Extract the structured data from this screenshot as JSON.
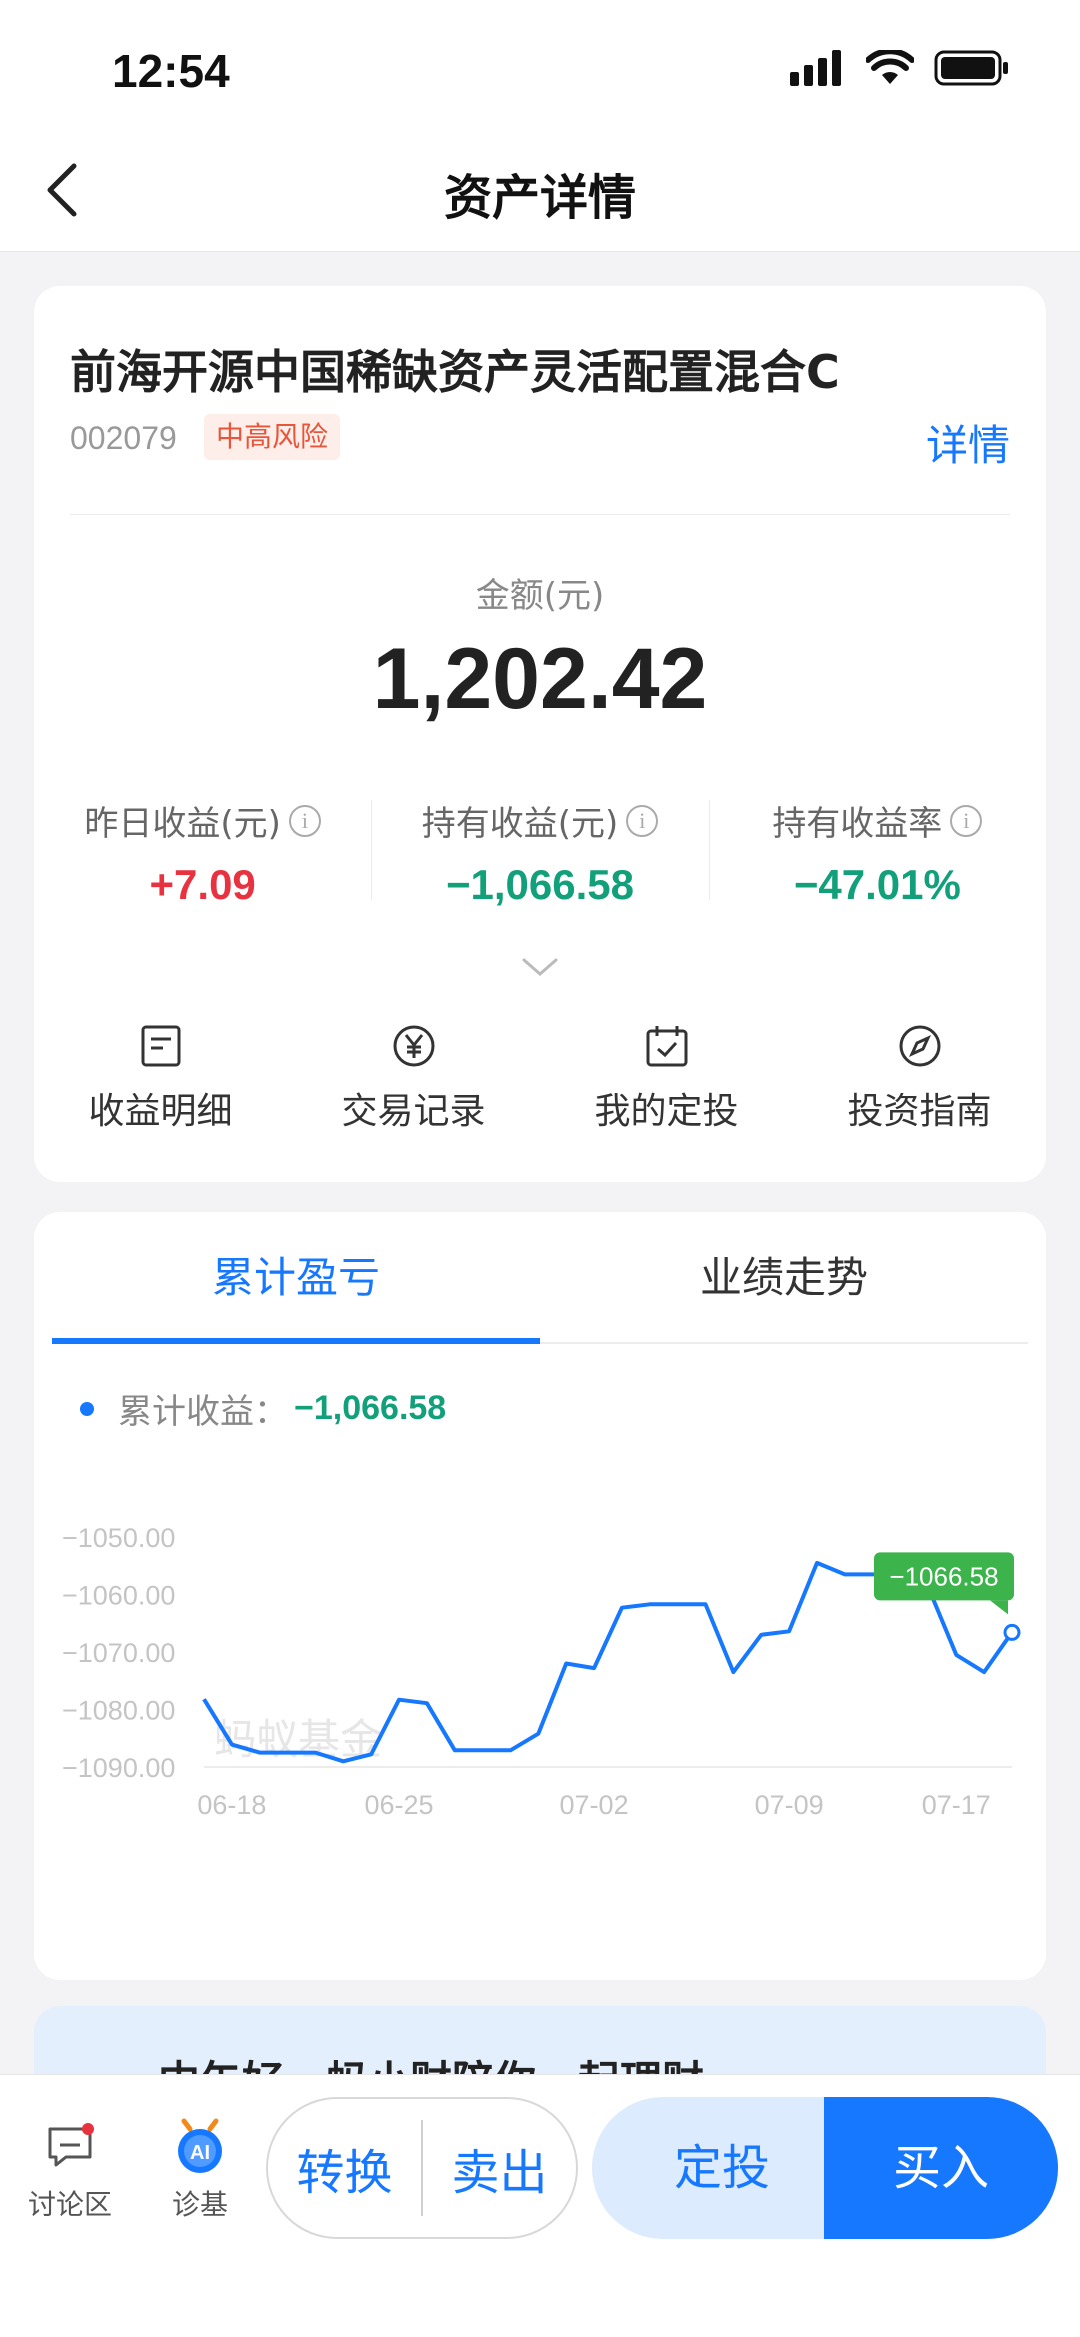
{
  "status": {
    "time": "12:54"
  },
  "nav": {
    "title": "资产详情"
  },
  "fund": {
    "name": "前海开源中国稀缺资产灵活配置混合C",
    "code": "002079",
    "risk": "中高风险",
    "detail_link": "详情",
    "amount_label": "金额(元)",
    "amount": "1,202.42",
    "stats": [
      {
        "label": "昨日收益(元)",
        "value": "+7.09"
      },
      {
        "label": "持有收益(元)",
        "value": "−1,066.58"
      },
      {
        "label": "持有收益率",
        "value": "−47.01%"
      }
    ],
    "actions": [
      {
        "label": "收益明细",
        "icon": "document-icon"
      },
      {
        "label": "交易记录",
        "icon": "yen-circle-icon"
      },
      {
        "label": "我的定投",
        "icon": "calendar-check-icon"
      },
      {
        "label": "投资指南",
        "icon": "compass-icon"
      }
    ]
  },
  "chart_panel": {
    "tabs": [
      "累计盈亏",
      "业绩走势"
    ],
    "legend_label": "累计收益：",
    "legend_value": "−1,066.58",
    "watermark": "蚂蚁基金",
    "tooltip": "−1066.58"
  },
  "chart_data": {
    "type": "line",
    "x_ticks": [
      "06-18",
      "06-25",
      "07-02",
      "07-09",
      "07-17"
    ],
    "y_ticks": [
      "−1050.00",
      "−1060.00",
      "−1070.00",
      "−1080.00",
      "−1090.00"
    ],
    "ylim": [
      -1090,
      -1050
    ],
    "series": [
      {
        "values": [
          -1078.2,
          -1086.1,
          -1087.5,
          -1087.5,
          -1087.5,
          -1089.0,
          -1087.8,
          -1078.3,
          -1078.9,
          -1087.1,
          -1087.1,
          -1087.1,
          -1084.2,
          -1072.0,
          -1072.8,
          -1062.3,
          -1061.7,
          -1061.7,
          -1061.7,
          -1073.5,
          -1067.0,
          -1066.4,
          -1054.5,
          -1056.5,
          -1056.5,
          -1056.5,
          -1058.8,
          -1070.5,
          -1073.5,
          -1066.58
        ]
      }
    ],
    "x_tick_index": [
      1,
      7,
      14,
      21,
      27
    ],
    "colors": {
      "line": "#1677ff",
      "tooltip": "#3cb44b"
    }
  },
  "promo": {
    "text": "中午好，蚂小财陪你一起理财~"
  },
  "bottom": {
    "discuss": "讨论区",
    "diagnose": "诊基",
    "convert": "转换",
    "sell": "卖出",
    "sip": "定投",
    "buy": "买入",
    "ai_badge": "AI"
  },
  "colors": {
    "accent": "#1677ff",
    "gain": "#e8323f",
    "loss": "#12a07a"
  }
}
